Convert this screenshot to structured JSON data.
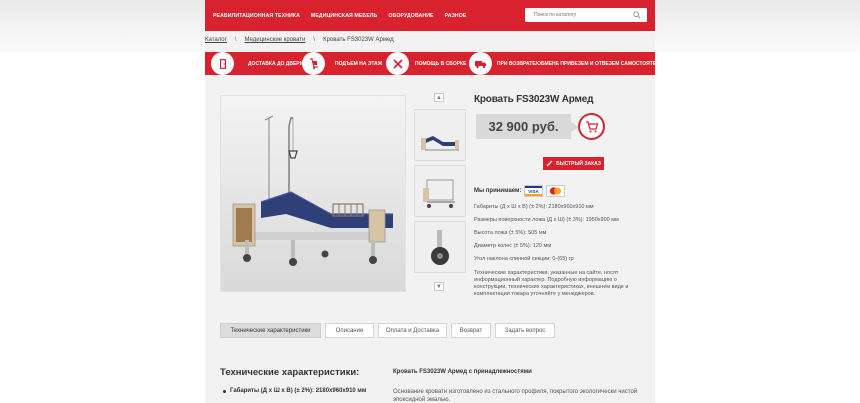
{
  "nav": {
    "items": [
      {
        "label": "РЕАБИЛИТАЦИОННАЯ ТЕХНИКА"
      },
      {
        "label": "МЕДИЦИНСКАЯ МЕБЕЛЬ"
      },
      {
        "label": "ОБОРУДОВАНИЕ"
      },
      {
        "label": "РАЗНОЕ"
      }
    ],
    "search_placeholder": "Поиск по каталогу"
  },
  "breadcrumb": {
    "items": [
      "Каталог",
      "Медицинские кровати",
      "Кровать FS3023W Армед"
    ],
    "separator": "\\"
  },
  "services": [
    {
      "label": "ДОСТАВКА ДО ДВЕРИ",
      "icon": "door-icon"
    },
    {
      "label": "ПОДЪЕМ НА ЭТАЖ",
      "icon": "hand-truck-icon"
    },
    {
      "label": "ПОМОЩЬ В СБОРКЕ",
      "icon": "tools-icon"
    },
    {
      "label": "ПРИ ВОЗВРАТЕ/ОБМЕНЕ ПРИВЕЗЕМ И ОТВЕЗЕМ САМОСТОЯТЕЛЬНО",
      "icon": "delivery-truck-icon"
    }
  ],
  "product": {
    "title": "Кровать FS3023W Армед",
    "price": "32 900 руб.",
    "quick_order": "БЫСТРЫЙ ЗАКАЗ",
    "accept_label": "Мы принимаем:",
    "cards": [
      "VISA",
      "MasterCard"
    ],
    "specs": [
      "Габариты (Д х Ш х В) (± 2%): 2180х960х910 мм",
      "Размеры поверхности ложа (Д х Ш) (± 3%): 1950х900 мм",
      "Высота ложа (± 5%): 505 мм",
      "Диаметр колес (± 5%): 120 мм",
      "Угол наклона спинной секции: 0-(65) гр"
    ],
    "note": "Технические характеристики, указанные на сайте, носят информационный характер. Подробную информацию о конструкции, технических характеристиках, внешнем виде и комплектации товара уточняйте у менеджеров."
  },
  "tabs": [
    {
      "label": "Технические характеристики",
      "active": true
    },
    {
      "label": "Описание",
      "active": false
    },
    {
      "label": "Оплата и Доставка",
      "active": false
    },
    {
      "label": "Возврат",
      "active": false
    },
    {
      "label": "Задать вопрос",
      "active": false
    }
  ],
  "specs_section": {
    "heading": "Технические характеристики:",
    "first_item": "Габариты (Д х Ш х В) (± 2%): 2180х960х910 мм"
  },
  "description_section": {
    "heading": "Кровать FS3023W Армед с принадлежностями",
    "text": "Основание кровати изготовлено из стального профиля, покрытого экологически чистой эпоксидной эмалью."
  },
  "colors": {
    "brand_red": "#d8232f",
    "price_bg": "#d9d9d9",
    "page_bg": "#f2f2f2",
    "mattress_blue": "#2f3f78"
  }
}
